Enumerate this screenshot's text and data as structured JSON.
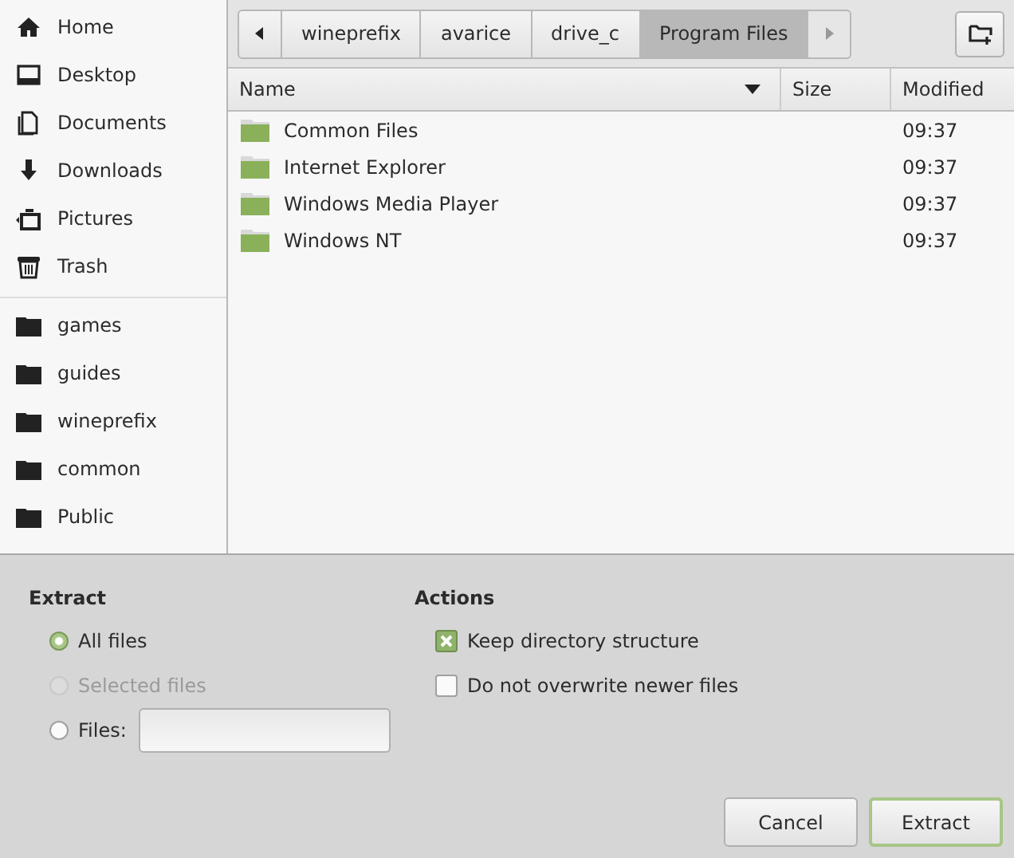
{
  "sidebar": {
    "places": [
      {
        "label": "Home"
      },
      {
        "label": "Desktop"
      },
      {
        "label": "Documents"
      },
      {
        "label": "Downloads"
      },
      {
        "label": "Pictures"
      },
      {
        "label": "Trash"
      }
    ],
    "bookmarks": [
      {
        "label": "games"
      },
      {
        "label": "guides"
      },
      {
        "label": "wineprefix"
      },
      {
        "label": "common"
      },
      {
        "label": "Public"
      }
    ]
  },
  "path_bar": {
    "segments": [
      {
        "label": "wineprefix",
        "selected": false
      },
      {
        "label": "avarice",
        "selected": false
      },
      {
        "label": "drive_c",
        "selected": false
      },
      {
        "label": "Program Files",
        "selected": true
      }
    ]
  },
  "file_list": {
    "columns": [
      "Name",
      "Size",
      "Modified"
    ],
    "rows": [
      {
        "name": "Common Files",
        "modified": "09:37"
      },
      {
        "name": "Internet Explorer",
        "modified": "09:37"
      },
      {
        "name": "Windows Media Player",
        "modified": "09:37"
      },
      {
        "name": "Windows NT",
        "modified": "09:37"
      }
    ]
  },
  "extract": {
    "title": "Extract",
    "options": [
      {
        "label": "All files",
        "selected": true,
        "disabled": false,
        "kind": "plain"
      },
      {
        "label": "Selected files",
        "selected": false,
        "disabled": true,
        "kind": "plain"
      },
      {
        "label": "Files:",
        "selected": false,
        "disabled": false,
        "kind": "field"
      }
    ]
  },
  "actions": {
    "title": "Actions",
    "options": [
      {
        "label": "Keep directory structure",
        "checked": true
      },
      {
        "label": "Do not overwrite newer files",
        "checked": false
      }
    ]
  },
  "buttons": [
    {
      "label": "Cancel",
      "kind": "normal"
    },
    {
      "label": "Extract",
      "kind": "default"
    }
  ]
}
